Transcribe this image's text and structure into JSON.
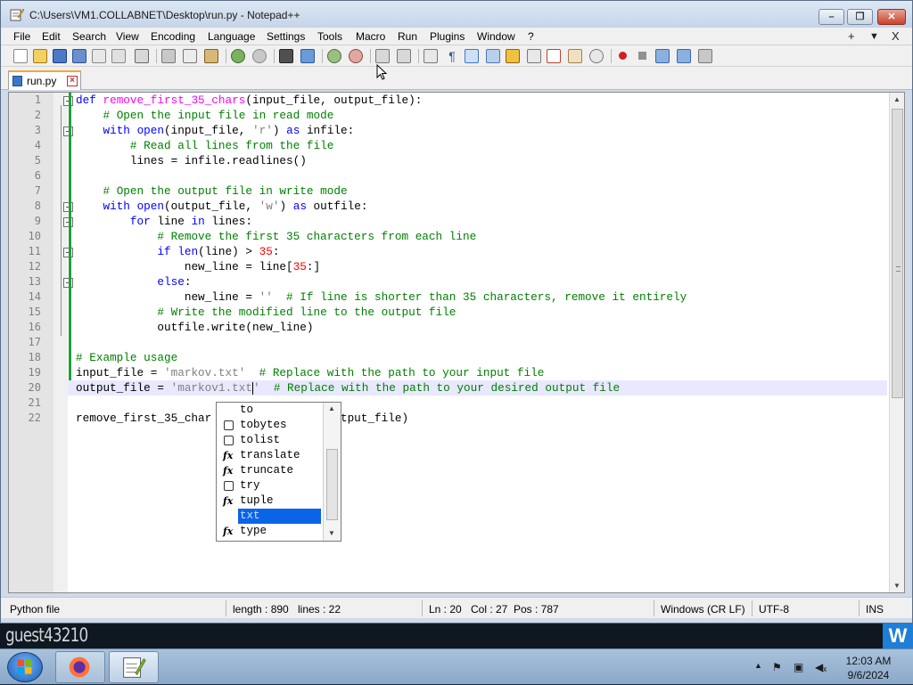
{
  "window": {
    "title": "C:\\Users\\VM1.COLLABNET\\Desktop\\run.py - Notepad++"
  },
  "menu": {
    "items": [
      "File",
      "Edit",
      "Search",
      "View",
      "Encoding",
      "Language",
      "Settings",
      "Tools",
      "Macro",
      "Run",
      "Plugins",
      "Window",
      "?"
    ],
    "right": [
      "+",
      "▼",
      "X"
    ]
  },
  "tabs": [
    {
      "label": "run.py",
      "active": true
    }
  ],
  "editor": {
    "lines": [
      {
        "num": "1"
      },
      {
        "num": "2"
      },
      {
        "num": "3"
      },
      {
        "num": "4"
      },
      {
        "num": "5"
      },
      {
        "num": "6"
      },
      {
        "num": "7"
      },
      {
        "num": "8"
      },
      {
        "num": "9"
      },
      {
        "num": "10"
      },
      {
        "num": "11"
      },
      {
        "num": "12"
      },
      {
        "num": "13"
      },
      {
        "num": "14"
      },
      {
        "num": "15"
      },
      {
        "num": "16"
      },
      {
        "num": "17"
      },
      {
        "num": "18"
      },
      {
        "num": "19"
      },
      {
        "num": "20"
      },
      {
        "num": "21"
      },
      {
        "num": "22"
      }
    ],
    "code": {
      "l1_kw": "def",
      "l1_fn": "remove_first_35_chars",
      "l1_rest": "(input_file, output_file):",
      "l2_cm": "# Open the input file in read mode",
      "l3_kw": "with",
      "l3_a": "open",
      "l3_b": "(input_file, ",
      "l3_st": "'r'",
      "l3_c": ") ",
      "l3_kw2": "as",
      "l3_d": " infile:",
      "l4_cm": "# Read all lines from the file",
      "l5": "lines = infile.readlines()",
      "l7_cm": "# Open the output file in write mode",
      "l8_kw": "with",
      "l8_a": "open",
      "l8_b": "(output_file, ",
      "l8_st": "'w'",
      "l8_c": ") ",
      "l8_kw2": "as",
      "l8_d": " outfile:",
      "l9_kw": "for",
      "l9_a": " line ",
      "l9_kw2": "in",
      "l9_b": " lines:",
      "l10_cm": "# Remove the first 35 characters from each line",
      "l11_kw": "if",
      "l11_a": "len",
      "l11_b": "(line) > ",
      "l11_nm": "35",
      "l11_c": ":",
      "l12_a": "new_line = line[",
      "l12_nm": "35",
      "l12_b": ":]",
      "l13_kw": "else",
      "l13_a": ":",
      "l14_a": "new_line = ",
      "l14_st": "''",
      "l14_cm": "  # If line is shorter than 35 characters, remove it entirely",
      "l15_cm": "# Write the modified line to the output file",
      "l16": "outfile.write(new_line)",
      "l18_cm": "# Example usage",
      "l19_a": "input_file = ",
      "l19_st": "'markov.txt'",
      "l19_cm": "  # Replace with the path to your input file",
      "l20_a": "output_file = ",
      "l20_st": "'markov1.txt",
      "l20_st2": "'",
      "l20_cm": "  # Replace with the path to your desired output file",
      "l22_a": "remove_first_35_char",
      "l22_b": "utput_file)"
    }
  },
  "autocomplete": {
    "items": [
      {
        "label": "to",
        "icon": "none"
      },
      {
        "label": "tobytes",
        "icon": "cube"
      },
      {
        "label": "tolist",
        "icon": "cube"
      },
      {
        "label": "translate",
        "icon": "fx"
      },
      {
        "label": "truncate",
        "icon": "fx"
      },
      {
        "label": "try",
        "icon": "cube"
      },
      {
        "label": "tuple",
        "icon": "fx"
      },
      {
        "label": "txt",
        "icon": "none",
        "selected": true
      },
      {
        "label": "type",
        "icon": "fx"
      }
    ],
    "fx_glyph": "fx"
  },
  "statusbar": {
    "filetype": "Python file",
    "length": "length : 890",
    "lines": "lines : 22",
    "ln": "Ln : 20",
    "col": "Col : 27",
    "pos": "Pos : 787",
    "eol": "Windows (CR LF)",
    "encoding": "UTF-8",
    "mode": "INS"
  },
  "desktop": {
    "label": "guest43210"
  },
  "taskbar": {
    "time": "12:03 AM",
    "date": "9/6/2024"
  },
  "colors": {
    "keyword": "#0000ff",
    "function": "#ff00ff",
    "comment": "#008000",
    "string": "#808080",
    "number": "#ff0000",
    "change_bar": "#1fa03a",
    "selection": "#0a64e6"
  }
}
